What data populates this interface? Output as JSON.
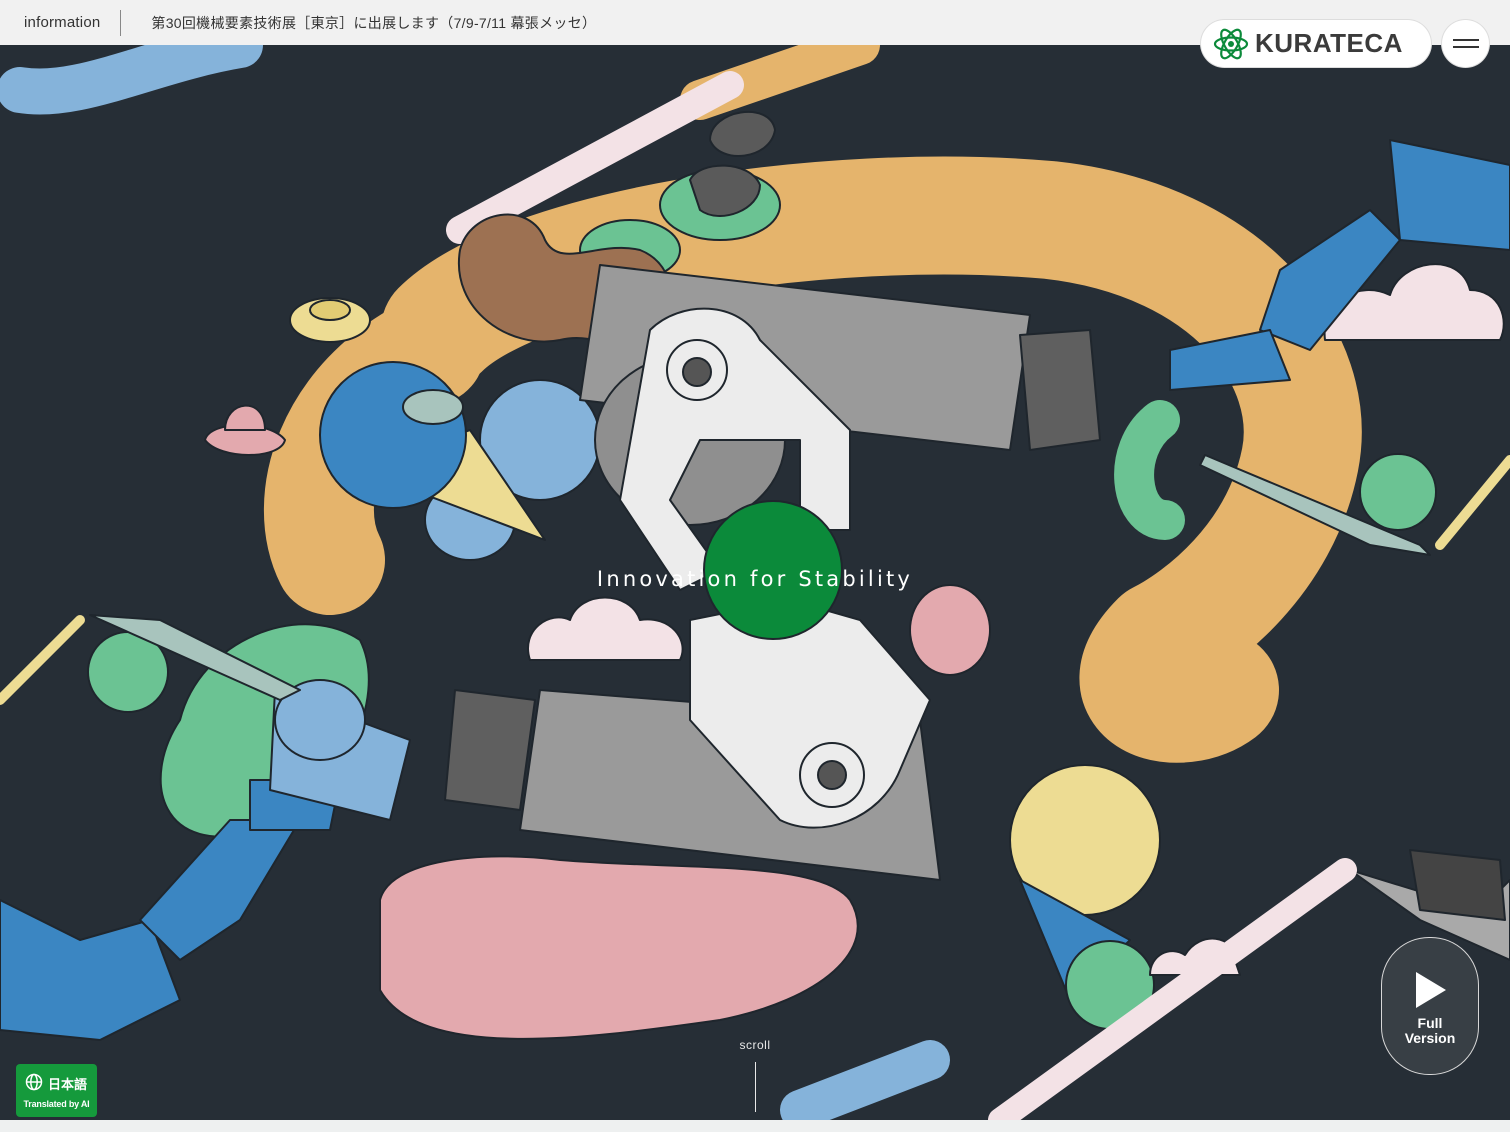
{
  "topbar": {
    "info_label": "information",
    "news_text": "第30回機械要素技術展［東京］に出展します（7/9-7/11 幕張メッセ）"
  },
  "logo": {
    "text": "KURATECA",
    "icon": "atom-logo-icon"
  },
  "menu": {
    "icon": "hamburger-menu-icon"
  },
  "hero": {
    "tagline": "Innovation for Stability"
  },
  "video_button": {
    "icon": "play-icon",
    "label": "Full Version"
  },
  "scroll": {
    "label": "scroll"
  },
  "language": {
    "icon": "globe-icon",
    "label": "日本語",
    "note": "Translated by AI"
  },
  "colors": {
    "background": "#262e36",
    "brand_green": "#0b8a3a",
    "language_button": "#159a3c",
    "orange": "#e5b46c",
    "blue": "#3b86c2",
    "light_blue": "#85b3da",
    "mint": "#6bc393",
    "pink": "#e3a9ae",
    "pale_pink": "#f3e2e6",
    "yellow": "#eddc93",
    "gray": "#9a9a9a"
  }
}
